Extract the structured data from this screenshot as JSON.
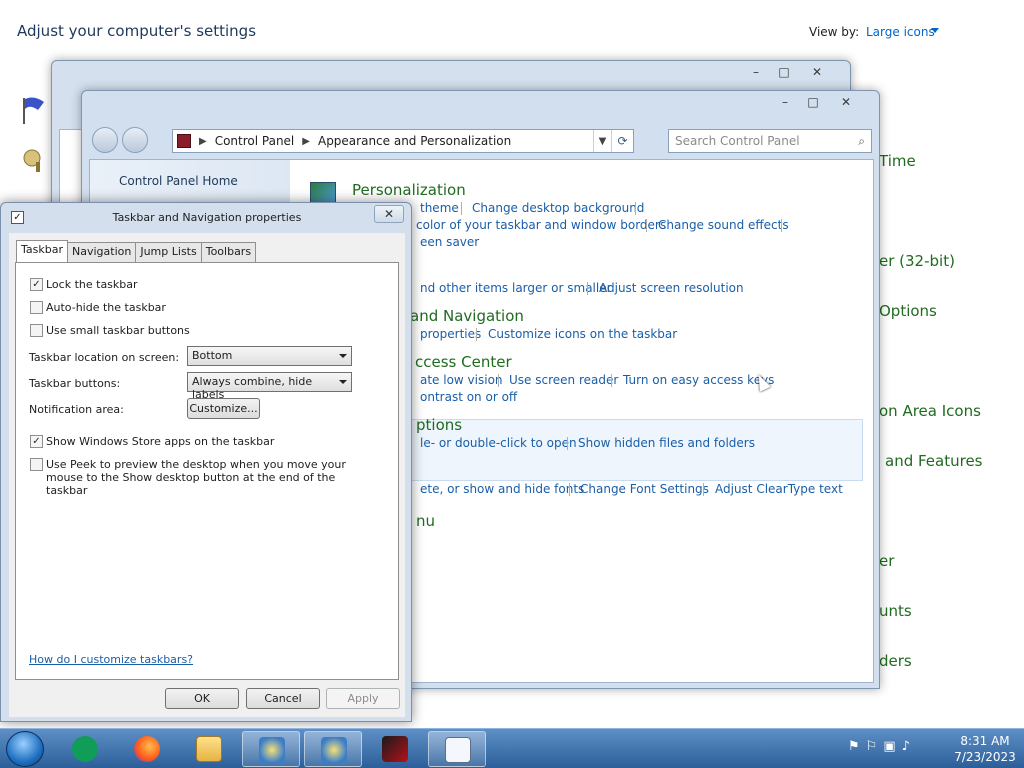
{
  "background_panel": {
    "title": "Adjust your computer's settings",
    "view_by_label": "View by:",
    "view_by_value": "Large icons",
    "right_items": [
      "Time",
      "er (32-bit)",
      "Options",
      "on Area Icons",
      "and Features",
      "er",
      "unts",
      "ders"
    ]
  },
  "explorer": {
    "breadcrumb": [
      "Control Panel",
      "Appearance and Personalization"
    ],
    "search_placeholder": "Search Control Panel",
    "left_home": "Control Panel Home",
    "categories": {
      "personalization": {
        "title": "Personalization",
        "links": [
          "theme",
          "Change desktop background",
          "color of your taskbar and window borders",
          "Change sound effects",
          "een saver"
        ]
      },
      "display": {
        "links": [
          "nd other items larger or smaller",
          "Adjust screen resolution"
        ]
      },
      "taskbar": {
        "title": "and Navigation",
        "links": [
          "properties",
          "Customize icons on the taskbar"
        ]
      },
      "ease": {
        "title": "ccess Center",
        "links": [
          "ate low vision",
          "Use screen reader",
          "Turn on easy access keys",
          "ontrast on or off"
        ]
      },
      "folder": {
        "title": "ptions",
        "links": [
          "le- or double-click to open",
          "Show hidden files and folders"
        ]
      },
      "fonts": {
        "links": [
          "ete, or show and hide fonts",
          "Change Font Settings",
          "Adjust ClearType text"
        ]
      },
      "navigation": {
        "title": "nu"
      }
    }
  },
  "dialog": {
    "title": "Taskbar and Navigation properties",
    "tabs": [
      "Taskbar",
      "Navigation",
      "Jump Lists",
      "Toolbars"
    ],
    "checkboxes": {
      "lock": {
        "label": "Lock the taskbar",
        "checked": true
      },
      "autohide": {
        "label": "Auto-hide the taskbar",
        "checked": false
      },
      "small": {
        "label": "Use small taskbar buttons",
        "checked": false
      },
      "store": {
        "label": "Show Windows Store apps on the taskbar",
        "checked": true
      },
      "peek": {
        "label": "Use Peek to preview the desktop when you move your mouse to the Show desktop button at the end of the taskbar",
        "checked": false
      }
    },
    "location_label": "Taskbar location on screen:",
    "location_value": "Bottom",
    "buttons_label": "Taskbar buttons:",
    "buttons_value": "Always combine, hide labels",
    "notif_label": "Notification area:",
    "customize_btn": "Customize...",
    "help_link": "How do I customize taskbars?",
    "ok": "OK",
    "cancel": "Cancel",
    "apply": "Apply"
  },
  "taskbar": {
    "time": "8:31 AM",
    "date": "7/23/2023"
  },
  "icons": {
    "minimize": "–",
    "maximize": "□",
    "close": "✕",
    "check": "✓"
  }
}
